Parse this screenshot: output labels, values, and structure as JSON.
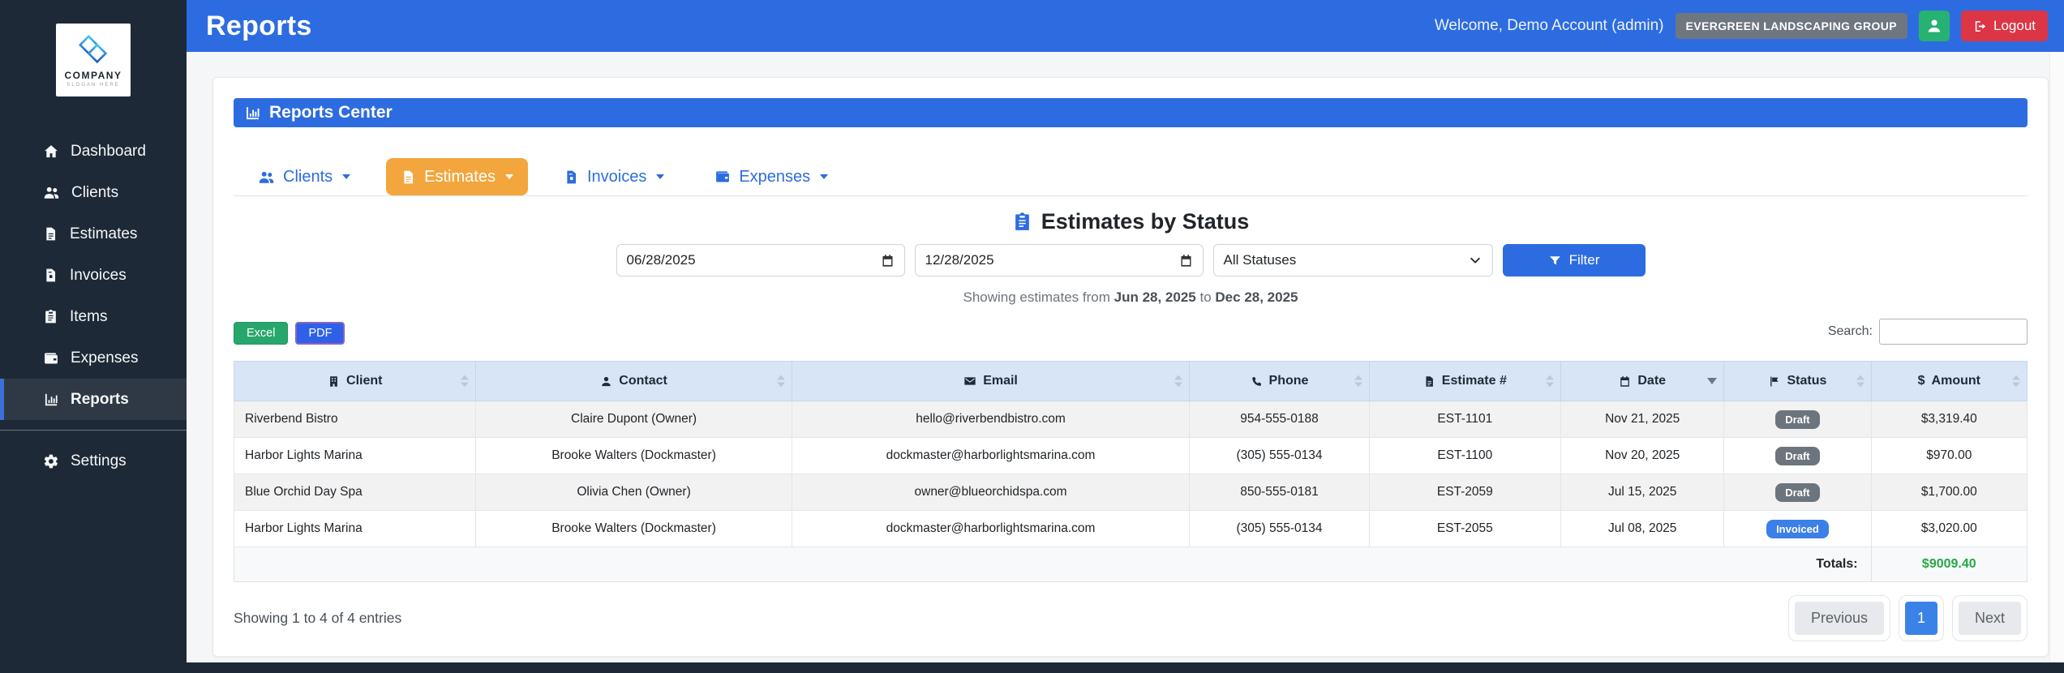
{
  "topbar": {
    "title": "Reports",
    "welcome": "Welcome, Demo Account (admin)",
    "org_badge": "EVERGREEN LANDSCAPING GROUP",
    "logout_label": "Logout"
  },
  "sidebar": {
    "logo_title": "COMPANY",
    "logo_subtitle": "SLOGAN HERE",
    "items": [
      {
        "label": "Dashboard"
      },
      {
        "label": "Clients"
      },
      {
        "label": "Estimates"
      },
      {
        "label": "Invoices"
      },
      {
        "label": "Items"
      },
      {
        "label": "Expenses"
      },
      {
        "label": "Reports",
        "active": true
      },
      {
        "label": "Settings"
      }
    ]
  },
  "reports_center": {
    "title": "Reports Center"
  },
  "tabs": [
    {
      "label": "Clients"
    },
    {
      "label": "Estimates",
      "active": true
    },
    {
      "label": "Invoices"
    },
    {
      "label": "Expenses"
    }
  ],
  "filters": {
    "title": "Estimates by Status",
    "date_from": "06/28/2025",
    "date_to": "12/28/2025",
    "status": "All Statuses",
    "filter_label": "Filter",
    "summary_prefix": "Showing estimates from",
    "summary_from": "Jun 28, 2025",
    "summary_join": "to",
    "summary_to": "Dec 28, 2025"
  },
  "export": {
    "excel_label": "Excel",
    "pdf_label": "PDF"
  },
  "search": {
    "label": "Search:",
    "value": ""
  },
  "table": {
    "headers": {
      "client": "Client",
      "contact": "Contact",
      "email": "Email",
      "phone": "Phone",
      "estimate": "Estimate #",
      "date": "Date",
      "status": "Status",
      "amount": "Amount"
    },
    "rows": [
      {
        "client": "Riverbend Bistro",
        "contact": "Claire Dupont (Owner)",
        "email": "hello@riverbendbistro.com",
        "phone": "954-555-0188",
        "estimate": "EST-1101",
        "date": "Nov 21, 2025",
        "status": "Draft",
        "amount": "$3,319.40"
      },
      {
        "client": "Harbor Lights Marina",
        "contact": "Brooke Walters (Dockmaster)",
        "email": "dockmaster@harborlightsmarina.com",
        "phone": "(305) 555-0134",
        "estimate": "EST-1100",
        "date": "Nov 20, 2025",
        "status": "Draft",
        "amount": "$970.00"
      },
      {
        "client": "Blue Orchid Day Spa",
        "contact": "Olivia Chen (Owner)",
        "email": "owner@blueorchidspa.com",
        "phone": "850-555-0181",
        "estimate": "EST-2059",
        "date": "Jul 15, 2025",
        "status": "Draft",
        "amount": "$1,700.00"
      },
      {
        "client": "Harbor Lights Marina",
        "contact": "Brooke Walters (Dockmaster)",
        "email": "dockmaster@harborlightsmarina.com",
        "phone": "(305) 555-0134",
        "estimate": "EST-2055",
        "date": "Jul 08, 2025",
        "status": "Invoiced",
        "amount": "$3,020.00"
      }
    ],
    "totals_label": "Totals:",
    "totals_value": "$9009.40"
  },
  "footer": {
    "entries": "Showing 1 to 4 of 4 entries",
    "previous": "Previous",
    "page": "1",
    "next": "Next"
  },
  "colors": {
    "accent_blue": "#2d6ce0",
    "active_tab_orange": "#f3a63d",
    "sidebar_navy": "#1d2936",
    "logout_red": "#dc3545",
    "user_button_green": "#27b173",
    "excel_green": "#28a76d",
    "pdf_blue": "#2e61e6",
    "header_row_blue": "#d8e5f6",
    "draft_badge_gray": "#6c757d",
    "invoiced_badge_blue": "#3b7fe8",
    "totals_green": "#28a745"
  }
}
